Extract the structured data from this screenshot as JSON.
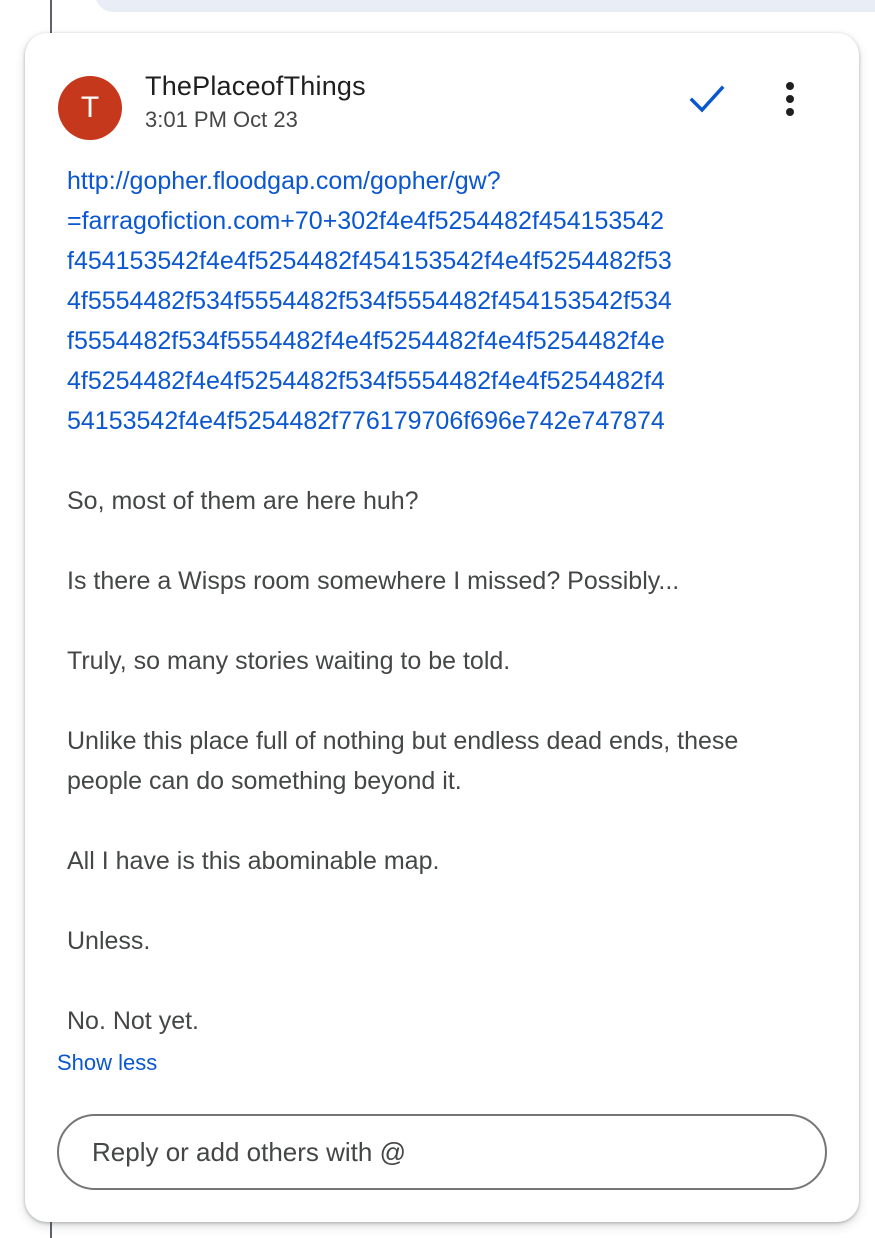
{
  "comment": {
    "avatar_initial": "T",
    "avatar_color": "#c5381c",
    "author": "ThePlaceofThings",
    "timestamp": "3:01 PM Oct 23",
    "resolve_icon": "checkmark-icon",
    "more_icon": "more-vert-icon",
    "link_text": "http://gopher.floodgap.com/gopher/gw?\n=farragofiction.com+70+302f4e4f5254482f454153542\nf454153542f4e4f5254482f454153542f4e4f5254482f53\n4f5554482f534f5554482f534f5554482f454153542f534\nf5554482f534f5554482f4e4f5254482f4e4f5254482f4e\n4f5254482f4e4f5254482f534f5554482f4e4f5254482f4\n54153542f4e4f5254482f776179706f696e742e747874",
    "paragraphs": [
      "So, most of them are here huh?",
      "Is there a Wisps room somewhere I missed? Possibly...",
      "Truly, so many stories waiting to be told.",
      "Unlike this place full of nothing but endless dead ends, these people can do something beyond it.",
      "All I have is this abominable map.",
      "Unless.",
      "No. Not yet."
    ],
    "show_less_label": "Show less"
  },
  "reply": {
    "placeholder": "Reply or add others with @"
  },
  "colors": {
    "link": "#0b57d0",
    "accent_check": "#0b57d0",
    "body_text": "#444746"
  }
}
